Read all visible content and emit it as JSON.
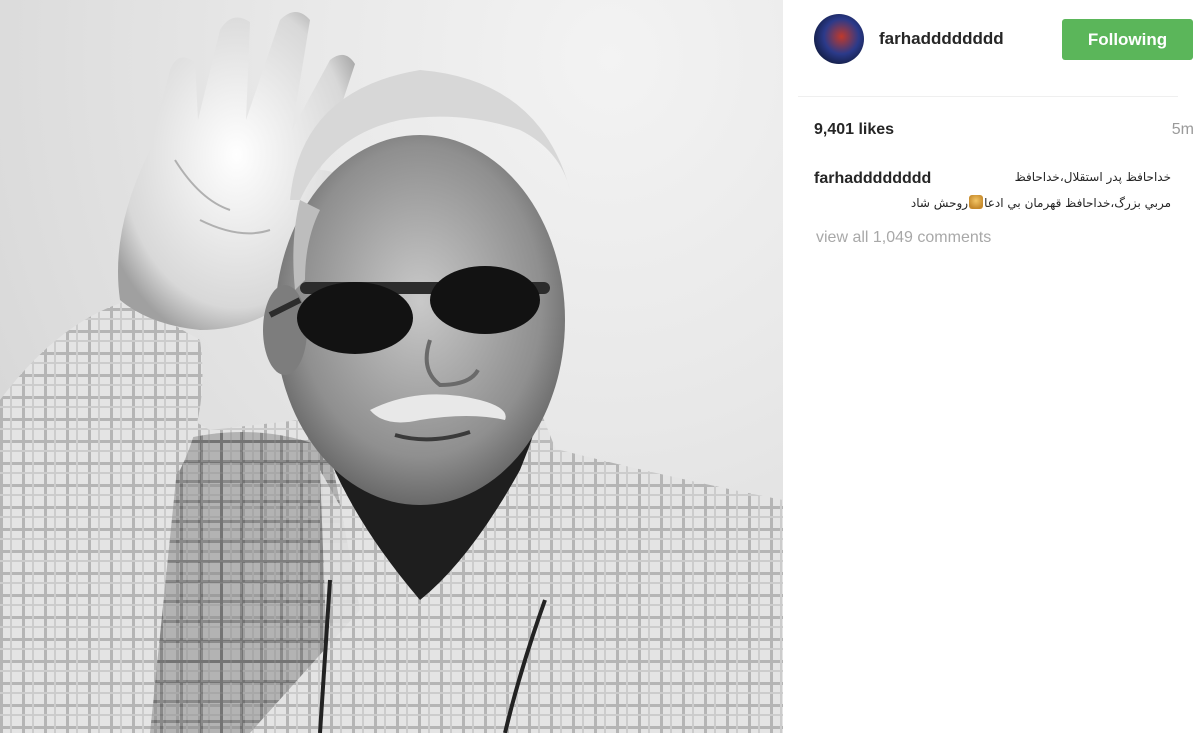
{
  "post": {
    "username": "farhadddddddd",
    "follow_button": "Following",
    "likes": "9,401 likes",
    "time_ago": "5m",
    "caption": {
      "username": "farhadddddddd",
      "line1": "خداحافظ پدر استقلال،خداحافظ",
      "line2_before_emoji": "مربي بزرگ،خداحافظ قهرمان بي ادعا",
      "line2_after_emoji": "روحش شاد"
    },
    "view_comments": "view all 1,049 comments"
  },
  "photo": {
    "subject": "Black and white portrait of an elderly man in sunglasses and plaid shirt waving"
  },
  "colors": {
    "follow_green": "#5bb65a",
    "muted_text": "#a8a8a8"
  }
}
